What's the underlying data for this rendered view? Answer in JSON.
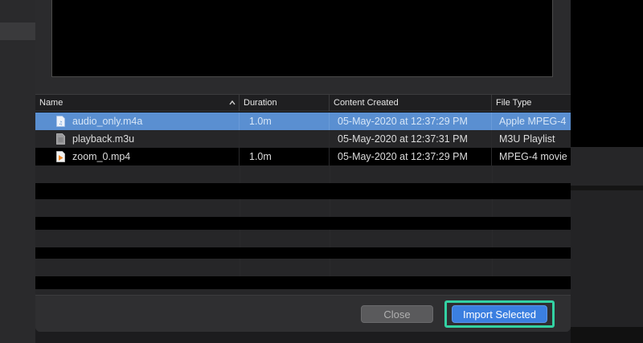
{
  "table": {
    "columns": [
      {
        "key": "name",
        "label": "Name"
      },
      {
        "key": "duration",
        "label": "Duration"
      },
      {
        "key": "created",
        "label": "Content Created"
      },
      {
        "key": "type",
        "label": "File Type"
      }
    ],
    "rows": [
      {
        "name": "audio_only.m4a",
        "duration": "1.0m",
        "created": "05-May-2020 at 12:37:29 PM",
        "type": "Apple MPEG-4",
        "icon": "audio-file-icon",
        "selected": true
      },
      {
        "name": "playback.m3u",
        "duration": "",
        "created": "05-May-2020 at 12:37:31 PM",
        "type": "M3U Playlist",
        "icon": "playlist-file-icon",
        "selected": false
      },
      {
        "name": "zoom_0.mp4",
        "duration": "1.0m",
        "created": "05-May-2020 at 12:37:29 PM",
        "type": "MPEG-4 movie",
        "icon": "video-file-icon",
        "selected": false
      }
    ],
    "sort_icon": "chevron-up-icon"
  },
  "buttons": {
    "close": "Close",
    "import": "Import Selected"
  },
  "colors": {
    "selection": "#5a8fd1",
    "import_button": "#3b7fe0",
    "highlight_frame": "#33d2a3"
  }
}
